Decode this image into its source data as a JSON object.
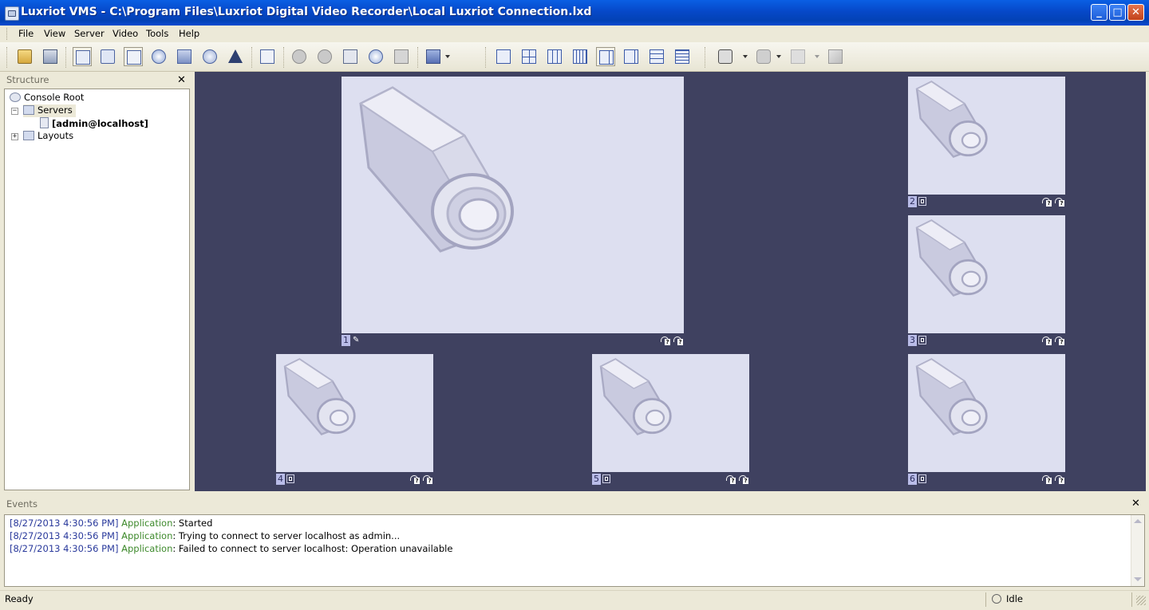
{
  "window": {
    "title": "Luxriot VMS - C:\\Program Files\\Luxriot Digital Video Recorder\\Local Luxriot Connection.lxd",
    "minimize_glyph": "_",
    "maximize_glyph": "□",
    "close_glyph": "✕"
  },
  "menu": {
    "items": [
      {
        "label": "File"
      },
      {
        "label": "View"
      },
      {
        "label": "Server"
      },
      {
        "label": "Video"
      },
      {
        "label": "Tools"
      },
      {
        "label": "Help"
      }
    ]
  },
  "toolbar": {
    "icons": [
      "open-icon",
      "save-icon",
      "structure-toggle-icon",
      "search-icon",
      "edit-icon",
      "globe-icon",
      "layout-editor-icon",
      "hdd-icon",
      "warning-icon",
      "fullscreen-icon",
      "ptz-icon",
      "camera-group-icon",
      "playback-icon",
      "sync-icon",
      "export-icon",
      "monitor-icon",
      "layout-1x1-icon",
      "layout-2x2-icon",
      "layout-3x3-icon",
      "layout-4x4-icon",
      "layout-1plus5-icon",
      "layout-1plus7-icon",
      "layout-3x3b-icon",
      "layout-4x4b-icon",
      "snapshot-icon",
      "hand-icon",
      "walker-icon",
      "windows-icon"
    ]
  },
  "structure": {
    "header": "Structure",
    "close_glyph": "✕",
    "tree": [
      {
        "label": "Console Root",
        "bold": false
      },
      {
        "label": "Servers",
        "bold": false,
        "expander": "−"
      },
      {
        "label": "[admin@localhost]",
        "bold": true
      },
      {
        "label": "Layouts",
        "bold": false,
        "expander": "+"
      }
    ]
  },
  "cameras": [
    {
      "number": "1",
      "icon": "pin-icon"
    },
    {
      "number": "2",
      "icon": "display-icon"
    },
    {
      "number": "3",
      "icon": "display-icon"
    },
    {
      "number": "4",
      "icon": "display-icon"
    },
    {
      "number": "5",
      "icon": "display-icon"
    },
    {
      "number": "6",
      "icon": "display-icon"
    }
  ],
  "events": {
    "header": "Events",
    "close_glyph": "✕",
    "lines": [
      {
        "time": "[8/27/2013 4:30:56 PM]",
        "source": "Application",
        "message": ": Started"
      },
      {
        "time": "[8/27/2013 4:30:56 PM]",
        "source": "Application",
        "message": ": Trying to connect to server localhost as admin..."
      },
      {
        "time": "[8/27/2013 4:30:56 PM]",
        "source": "Application",
        "message": ": Failed to connect to server localhost: Operation unavailable"
      }
    ]
  },
  "status": {
    "left": "Ready",
    "right": "Idle"
  },
  "colors": {
    "video_background": "#3f4160",
    "camera_tile": "#dddff0",
    "event_time": "#2a3a9c",
    "event_source": "#3e8a2c"
  }
}
